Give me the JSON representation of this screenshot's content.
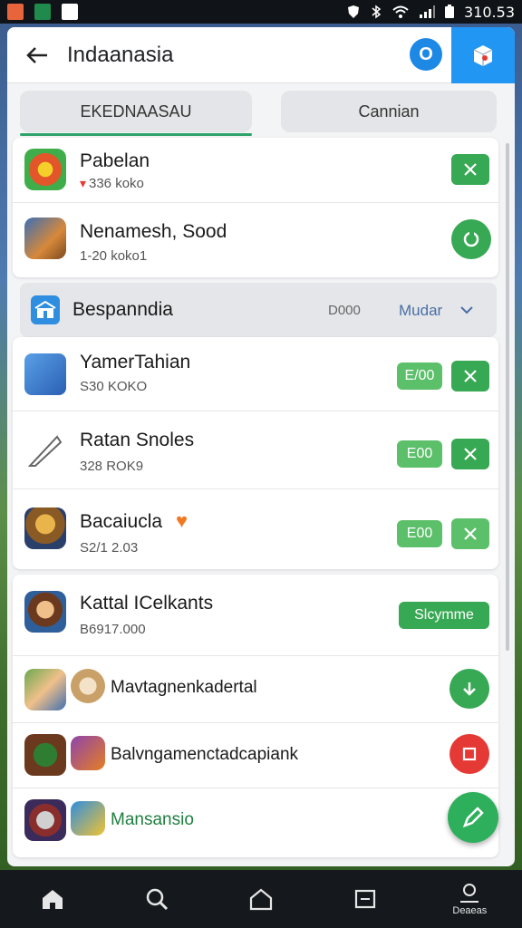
{
  "header": {
    "title": "Indaanasia",
    "circle_letter": "O"
  },
  "tabs": [
    {
      "label": "EKEDNAASAU"
    },
    {
      "label": "Cannian"
    }
  ],
  "top_items": [
    {
      "title": "Pabelan",
      "subtitle": "336 koko"
    },
    {
      "title": "Nenamesh, Sood",
      "subtitle": "1-20 koko1"
    }
  ],
  "section": {
    "title": "Bespanndia",
    "count": "D000",
    "action": "Mudar"
  },
  "section_items": [
    {
      "title": "YamerTahian",
      "subtitle": "S30 KOKO",
      "badge": "E/00"
    },
    {
      "title": "Ratan Snoles",
      "subtitle": "328 ROK9",
      "badge": "E00"
    },
    {
      "title": "Bacaiucla",
      "subtitle": "S2/1 2.03",
      "badge": "E00"
    }
  ],
  "lower_items": [
    {
      "title": "Kattal ICelkants",
      "subtitle": "B6917.000",
      "badge": "Slcymme"
    },
    {
      "title": "Mavtagnenkadertal"
    },
    {
      "title": "Balvngamenctadcapiank"
    },
    {
      "title": "Mansansio"
    }
  ],
  "nav": {
    "account_label": "Deaeas"
  },
  "colors": {
    "accent_green": "#37a853",
    "header_blue": "#2196f3",
    "red": "#e53935"
  },
  "status": {
    "time": "310.53"
  }
}
